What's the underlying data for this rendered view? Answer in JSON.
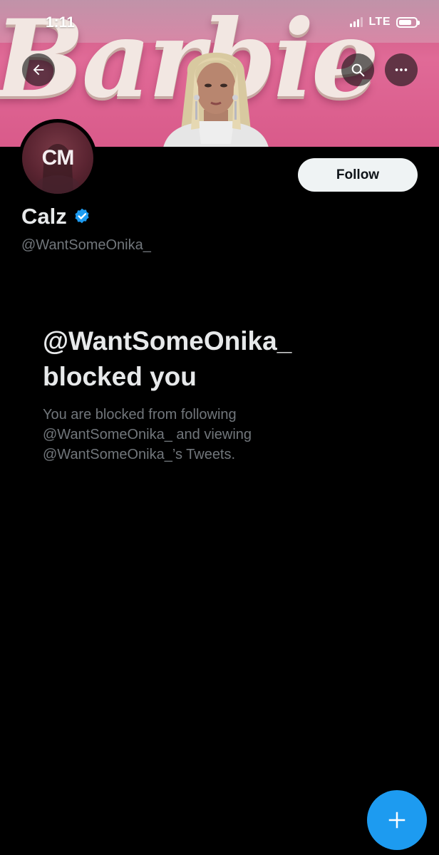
{
  "status_bar": {
    "time": "1:11",
    "network": "LTE",
    "battery_level": 0.75
  },
  "banner": {
    "wordmark": "Barbie",
    "colors": {
      "primary": "#e06a97",
      "text": "#f2e7e2"
    }
  },
  "nav": {
    "back_icon": "arrow-left-icon",
    "search_icon": "search-icon",
    "more_icon": "more-horizontal-icon"
  },
  "profile": {
    "avatar_initials": "CM",
    "display_name": "Calz",
    "verified": true,
    "verified_color": "#1d9bf0",
    "handle": "@WantSomeOnika_",
    "follow_label": "Follow"
  },
  "blocked": {
    "title_line1": "@WantSomeOnika_",
    "title_line2": "blocked you",
    "desc_line1": "You are blocked from following",
    "desc_line2": "@WantSomeOnika_ and viewing",
    "desc_line3": "@WantSomeOnika_’s Tweets."
  },
  "fab": {
    "icon": "plus-icon",
    "color": "#1d9bf0"
  }
}
